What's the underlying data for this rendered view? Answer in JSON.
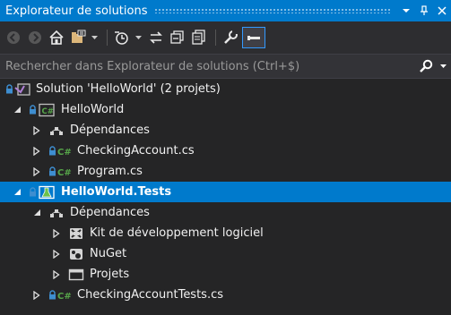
{
  "window": {
    "title": "Explorateur de solutions",
    "pin_glyph": "▾",
    "pin2_glyph": "⊥",
    "close_glyph": "✕"
  },
  "toolbar": {
    "buttons": [
      "back-icon",
      "forward-icon",
      "home-icon",
      "switch-views-icon",
      "pending-changes-filter-icon",
      "sync-with-active-document-icon",
      "collapse-all-icon",
      "show-all-files-icon",
      "properties-icon",
      "preview-selected-items-icon"
    ]
  },
  "search": {
    "placeholder": "Rechercher dans Explorateur de solutions (Ctrl+$)"
  },
  "tree": [
    {
      "label": "Solution 'HelloWorld' (2 projets)",
      "icon": "solution-icon",
      "level": 0,
      "expander": "none",
      "lock": true
    },
    {
      "label": "HelloWorld",
      "icon": "csharp-project-icon",
      "level": 0,
      "expander": "expanded",
      "lock": true
    },
    {
      "label": "Dépendances",
      "icon": "dependencies-icon",
      "level": 1,
      "expander": "collapsed",
      "lock": false
    },
    {
      "label": "CheckingAccount.cs",
      "icon": "csharp-file-icon",
      "level": 1,
      "expander": "collapsed",
      "lock": true
    },
    {
      "label": "Program.cs",
      "icon": "csharp-file-icon",
      "level": 1,
      "expander": "collapsed",
      "lock": true
    },
    {
      "label": "HelloWorld.Tests",
      "icon": "test-project-icon",
      "level": 0,
      "expander": "expanded",
      "lock": true,
      "selected": true
    },
    {
      "label": "Dépendances",
      "icon": "dependencies-icon",
      "level": 1,
      "expander": "expanded",
      "lock": false
    },
    {
      "label": "Kit de développement logiciel",
      "icon": "sdk-icon",
      "level": 2,
      "expander": "collapsed",
      "lock": false
    },
    {
      "label": "NuGet",
      "icon": "nuget-icon",
      "level": 2,
      "expander": "collapsed",
      "lock": false
    },
    {
      "label": "Projets",
      "icon": "projects-icon",
      "level": 2,
      "expander": "collapsed",
      "lock": false
    },
    {
      "label": "CheckingAccountTests.cs",
      "icon": "csharp-file-icon",
      "level": 1,
      "expander": "collapsed",
      "lock": true
    }
  ],
  "colors": {
    "accent": "#007acc",
    "background": "#252526",
    "toolbar": "#2d2d30",
    "search_bg": "#333337",
    "text": "#f1f1f1",
    "csharp_green": "#57a64a",
    "lock_blue": "#3e8ed0"
  }
}
